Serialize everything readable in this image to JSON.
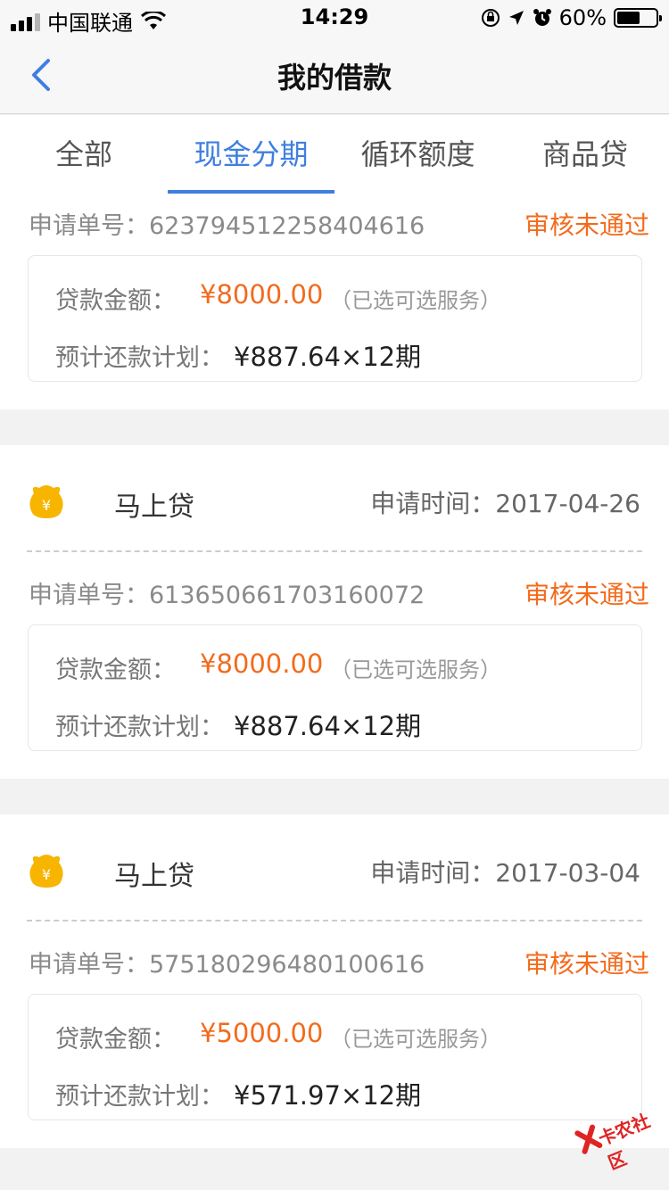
{
  "status_bar": {
    "carrier": "中国联通",
    "time": "14:29",
    "battery_text": "60%",
    "battery_level": 0.6
  },
  "nav": {
    "title": "我的借款"
  },
  "tabs": [
    {
      "label": "全部",
      "active": false
    },
    {
      "label": "现金分期",
      "active": true
    },
    {
      "label": "循环额度",
      "active": false
    },
    {
      "label": "商品贷",
      "active": false
    }
  ],
  "loans": [
    {
      "order_label": "申请单号：",
      "order_no": "623794512258404616",
      "status": "审核未通过",
      "amount_label": "贷款金额：",
      "amount": "¥8000.00",
      "service_note": "（已选可选服务）",
      "plan_label": "预计还款计划：",
      "plan": "¥887.64×12期"
    },
    {
      "app_name": "马上贷",
      "time_label": "申请时间：",
      "apply_time": "2017-04-26",
      "order_label": "申请单号：",
      "order_no": "613650661703160072",
      "status": "审核未通过",
      "amount_label": "贷款金额：",
      "amount": "¥8000.00",
      "service_note": "（已选可选服务）",
      "plan_label": "预计还款计划：",
      "plan": "¥887.64×12期"
    },
    {
      "app_name": "马上贷",
      "time_label": "申请时间：",
      "apply_time": "2017-03-04",
      "order_label": "申请单号：",
      "order_no": "575180296480100616",
      "status": "审核未通过",
      "amount_label": "贷款金额：",
      "amount": "¥5000.00",
      "service_note": "（已选可选服务）",
      "plan_label": "预计还款计划：",
      "plan": "¥571.97×12期"
    }
  ],
  "watermark": {
    "text": "卡农社区"
  },
  "colors": {
    "accent": "#3e7fe0",
    "status": "#f26b1d",
    "logo": "#f7b500"
  }
}
